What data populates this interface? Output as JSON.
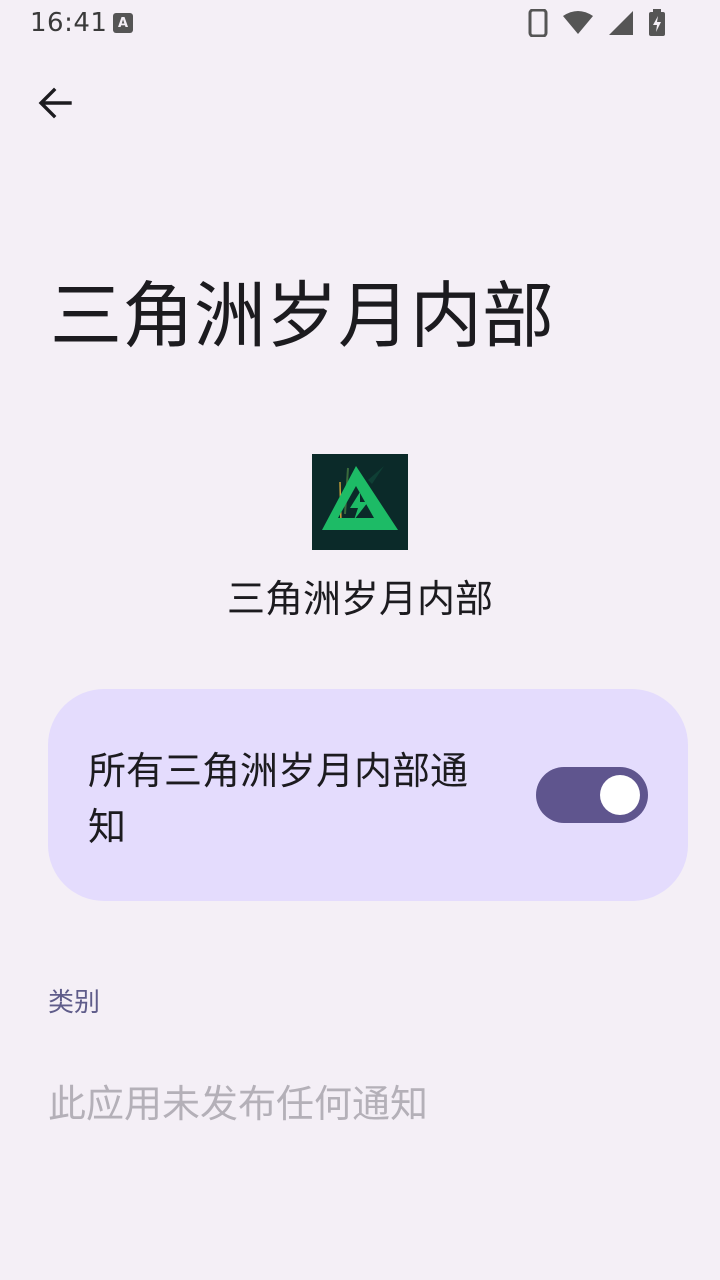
{
  "status_bar": {
    "time": "16:41",
    "icons": [
      "keyboard-a-icon",
      "phone-icon",
      "wifi-icon",
      "cell-signal-icon",
      "battery-charging-icon"
    ]
  },
  "header": {
    "back_icon": "arrow-back-icon",
    "title": "三角洲岁月内部"
  },
  "app": {
    "name": "三角洲岁月内部",
    "icon": "app-logo-icon"
  },
  "notification_toggle": {
    "label": "所有三角洲岁月内部通知",
    "enabled": true
  },
  "categories": {
    "header": "类别",
    "empty_message": "此应用未发布任何通知"
  },
  "colors": {
    "background": "#f4eff6",
    "card": "#e4dcfd",
    "toggle_track": "#5f558e",
    "section_header": "#5f5c8a",
    "muted_text": "#b4b0b8"
  }
}
